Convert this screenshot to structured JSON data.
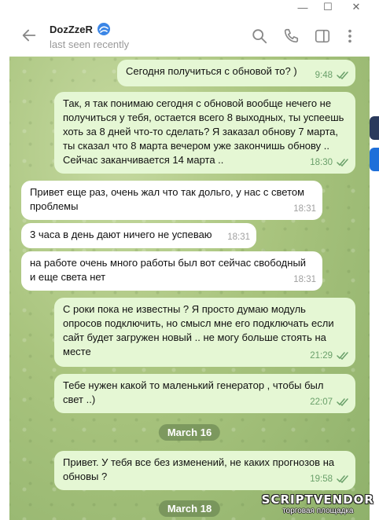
{
  "window": {
    "minimize": "—",
    "maximize": "☐",
    "close": "✕"
  },
  "header": {
    "name": "DozZzeR",
    "status": "last seen recently",
    "icons": [
      "back-arrow-icon",
      "search-icon",
      "phone-icon",
      "sidebar-toggle-icon",
      "more-vertical-icon"
    ],
    "emoji_status": "blue-swirl-badge"
  },
  "messages": [
    {
      "direction": "out",
      "text": "Сегодня получиться с обновой то? )",
      "time": "9:48",
      "read": true
    },
    {
      "direction": "out",
      "text": "Так, я так понимаю сегодня с обновой вообще нечего не получиться у тебя, остается всего 8 выходных, ты успеешь хоть за 8 дней что-то сделать? Я заказал обнову 7 марта, ты сказал что 8 марта вечером уже закончишь обнову .. Сейчас заканчивается 14 марта ..",
      "time": "18:30",
      "read": true
    },
    {
      "direction": "in",
      "text": "Привет еще раз, очень жал что так дольго, у нас с светом проблемы",
      "time": "18:31"
    },
    {
      "direction": "in",
      "text": "3 часа в день дают ничего не успеваю",
      "time": "18:31"
    },
    {
      "direction": "in",
      "text": "на работе очень много работы был вот сейчас свободный и еще света нет",
      "time": "18:31"
    },
    {
      "direction": "out",
      "text": "С роки пока не известны ? Я просто думаю модуль опросов подключить, но смысл мне его подключать если сайт будет загружен новый .. не могу больше стоять на месте",
      "time": "21:29",
      "read": true
    },
    {
      "direction": "out",
      "text": "Тебе нужен какой то маленький генератор , чтобы был свет ..)",
      "time": "22:07",
      "read": true
    },
    {
      "direction": "out",
      "text": "Привет. У тебя все без изменений, не каких прогнозов на обновы ?",
      "time": "19:58",
      "read": true
    }
  ],
  "dates": [
    "March 16",
    "March 18"
  ],
  "watermark": {
    "brand": "SCRIPTVENDOR",
    "tagline": "торговая площадка"
  },
  "colors": {
    "outgoing": "#e5f7d4",
    "incoming": "#ffffff",
    "time_out": "#6aa06a",
    "date_pill": "#5c7848"
  }
}
